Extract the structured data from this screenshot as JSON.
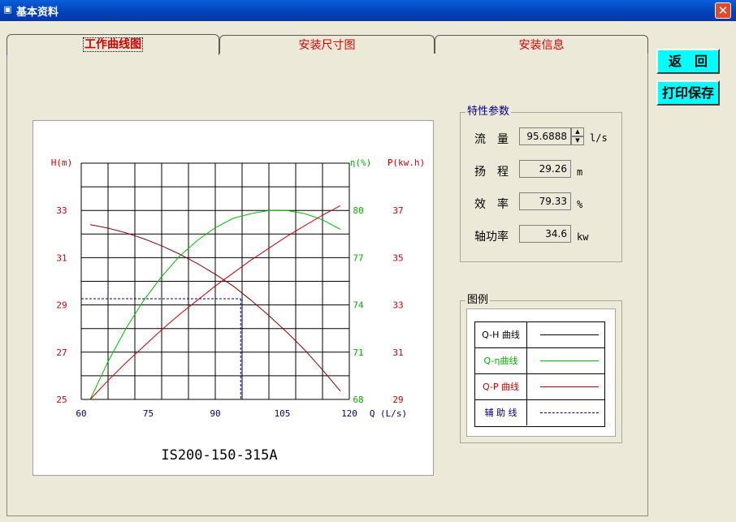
{
  "window": {
    "title": "基本资料",
    "close_glyph": "✕"
  },
  "tabs": [
    {
      "label": "工作曲线图",
      "active": true
    },
    {
      "label": "安装尺寸图",
      "active": false
    },
    {
      "label": "安装信息",
      "active": false
    }
  ],
  "buttons": {
    "back": "返　回",
    "print_save": "打印保存"
  },
  "params": {
    "group_title": "特性参数",
    "flow": {
      "label": "流　量",
      "value": "95.6888",
      "unit": "l/s"
    },
    "head": {
      "label": "扬　程",
      "value": "29.26",
      "unit": "m"
    },
    "efficiency": {
      "label": "效　率",
      "value": "79.33",
      "unit": "%"
    },
    "power": {
      "label": "轴功率",
      "value": "34.6",
      "unit": "kw"
    }
  },
  "legend": {
    "group_title": "图例",
    "items": [
      {
        "label": "Q-H 曲线",
        "color": "#000000",
        "dashed": false
      },
      {
        "label": "Q-η曲线",
        "color": "#00b000",
        "dashed": false
      },
      {
        "label": "Q-P 曲线",
        "color": "#cc0000",
        "dashed": false
      },
      {
        "label": "辅 助 线",
        "color": "#000080",
        "dashed": true
      }
    ]
  },
  "chart_data": {
    "type": "line",
    "title": "IS200-150-315A",
    "xlabel": "Q (L/s)",
    "xlim": [
      60,
      120
    ],
    "x_ticks": [
      "60",
      "75",
      "90",
      "105",
      "120"
    ],
    "y_axes": {
      "head": {
        "label": "H(m)",
        "lim": [
          25,
          35
        ],
        "ticks": [
          "25",
          "27",
          "29",
          "31",
          "33"
        ],
        "color": "#cc0000"
      },
      "efficiency": {
        "label": "η(%)",
        "lim": [
          68,
          83
        ],
        "ticks": [
          "68",
          "71",
          "74",
          "77",
          "80"
        ],
        "color": "#00b000"
      },
      "power": {
        "label": "P(kw.h)",
        "lim": [
          29,
          39
        ],
        "ticks": [
          "29",
          "31",
          "33",
          "35",
          "37"
        ],
        "color": "#cc0000"
      }
    },
    "series": [
      {
        "name": "Q-H",
        "color": "#8b0000",
        "axis": "head",
        "x": [
          62,
          66,
          70,
          74,
          78,
          82,
          86,
          90,
          94,
          98,
          102,
          106,
          110,
          114,
          118
        ],
        "y": [
          32.4,
          32.25,
          32.05,
          31.8,
          31.5,
          31.15,
          30.75,
          30.3,
          29.8,
          29.2,
          28.55,
          27.85,
          27.1,
          26.25,
          25.35
        ]
      },
      {
        "name": "Q-η",
        "color": "#00c000",
        "axis": "efficiency",
        "x": [
          62,
          66,
          70,
          74,
          78,
          82,
          86,
          90,
          94,
          98,
          102,
          106,
          110,
          114,
          118
        ],
        "y": [
          68.0,
          70.4,
          72.5,
          74.3,
          75.8,
          77.1,
          78.1,
          78.9,
          79.5,
          79.8,
          80.0,
          80.0,
          79.8,
          79.4,
          78.8
        ]
      },
      {
        "name": "Q-P",
        "color": "#cc0000",
        "axis": "power",
        "x": [
          62,
          66,
          70,
          74,
          78,
          82,
          86,
          90,
          94,
          98,
          102,
          106,
          110,
          114,
          118
        ],
        "y": [
          29.0,
          29.8,
          30.55,
          31.25,
          31.95,
          32.6,
          33.2,
          33.8,
          34.35,
          34.9,
          35.4,
          35.9,
          36.35,
          36.8,
          37.2
        ]
      }
    ],
    "operating_point": {
      "q": 95.6888,
      "head": 29.26
    }
  }
}
